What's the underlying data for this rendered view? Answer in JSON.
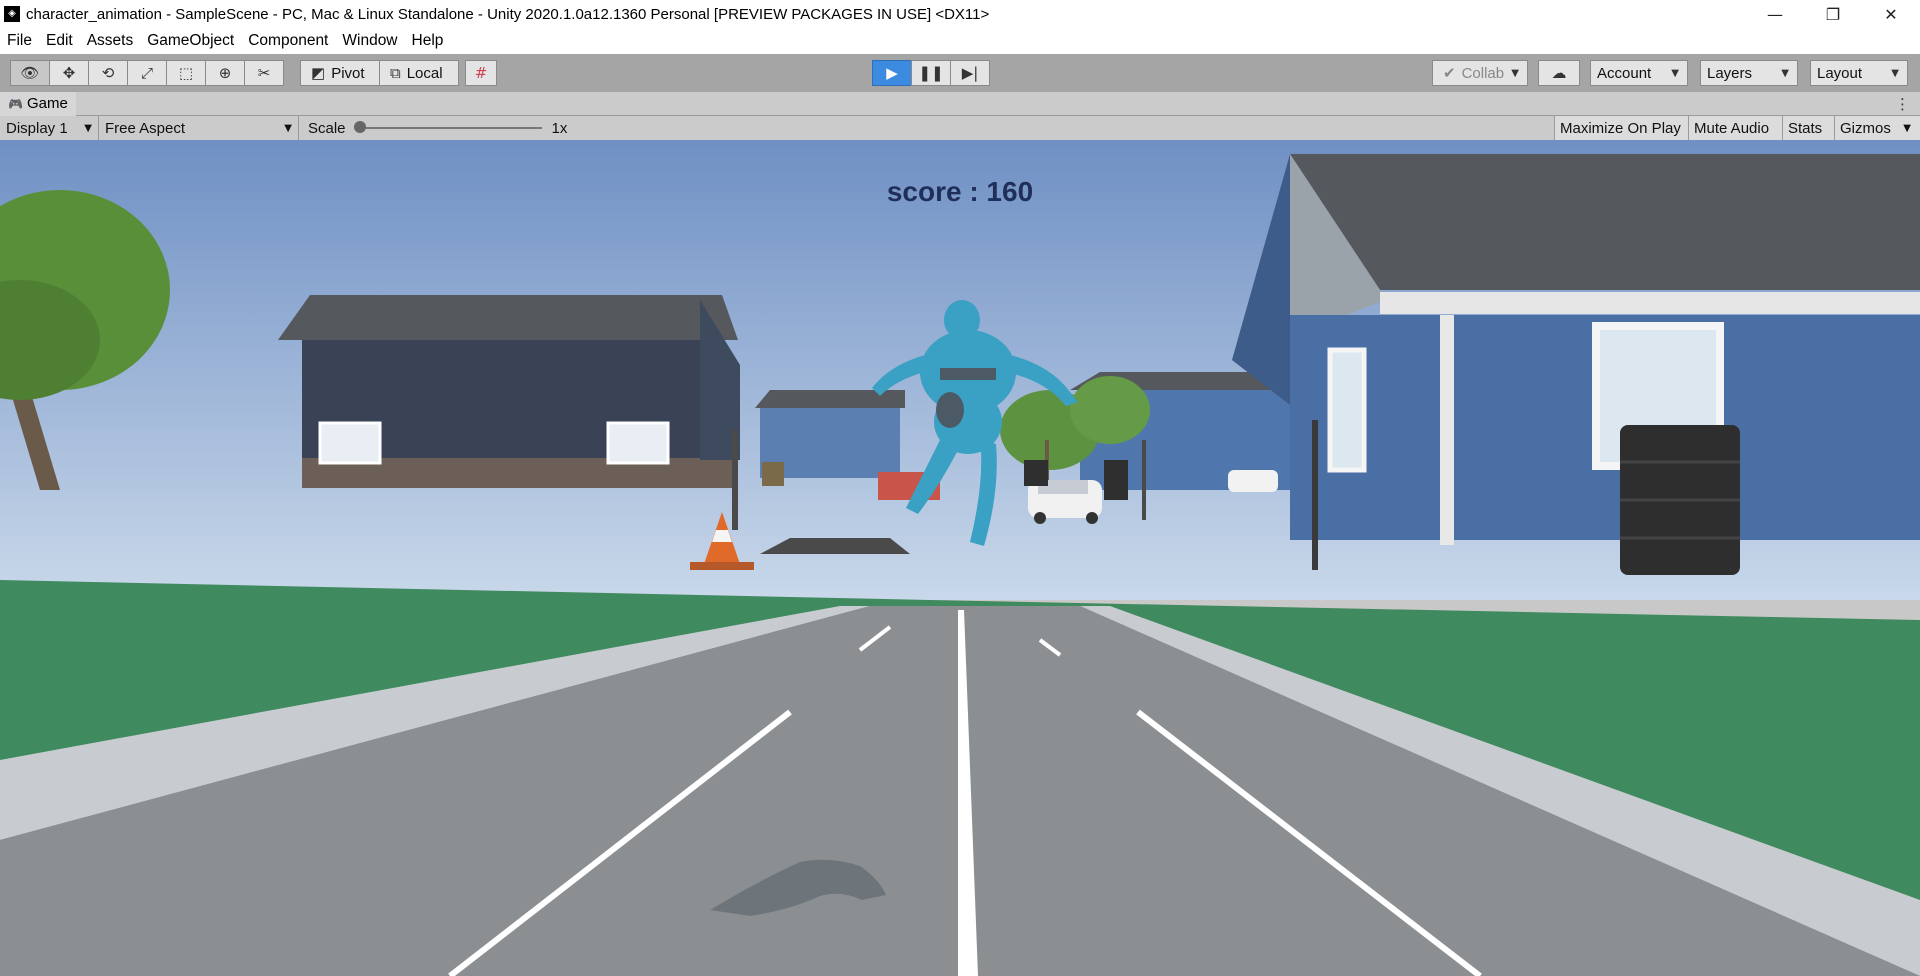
{
  "window": {
    "title": "character_animation - SampleScene - PC, Mac & Linux Standalone - Unity 2020.1.0a12.1360 Personal [PREVIEW PACKAGES IN USE] <DX11>",
    "controls": {
      "minimize": "—",
      "restore": "❐",
      "close": "✕"
    }
  },
  "menu": [
    "File",
    "Edit",
    "Assets",
    "GameObject",
    "Component",
    "Window",
    "Help"
  ],
  "toolbar": {
    "tools": [
      "view-tool",
      "move-tool",
      "rotate-tool",
      "scale-tool",
      "rect-tool",
      "transform-tool",
      "custom-tool"
    ],
    "pivot_label": "Pivot",
    "local_label": "Local",
    "collab_label": "Collab",
    "account_label": "Account",
    "layers_label": "Layers",
    "layout_label": "Layout"
  },
  "game_tab": {
    "label": "Game"
  },
  "game_bar": {
    "display": "Display 1",
    "aspect": "Free Aspect",
    "scale_label": "Scale",
    "scale_value": "1x",
    "maximize_on_play": "Maximize On Play",
    "mute_audio": "Mute Audio",
    "stats": "Stats",
    "gizmos": "Gizmos"
  },
  "game": {
    "score_text": "score : 160"
  },
  "colors": {
    "play_active": "#3c8be0",
    "sky_top": "#6f90c4",
    "sky_bottom": "#bcd0e8",
    "grass": "#3f8a5e",
    "road": "#8c8f92",
    "character": "#3aa0c4",
    "house_blue": "#4a6fa5",
    "house_dark": "#3a4256"
  }
}
